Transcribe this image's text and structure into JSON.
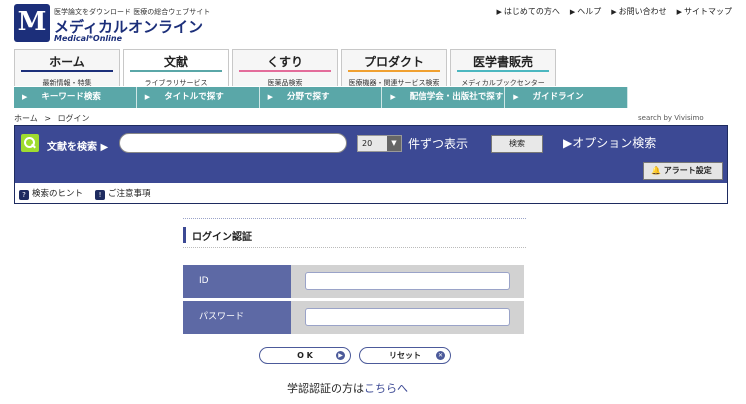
{
  "logo": {
    "mark": "M",
    "tagline": "医学論文をダウンロード 医療の総合ウェブサイト",
    "name": "メディカルオンライン",
    "name_en": "Medical*Online"
  },
  "toplinks": [
    {
      "label": "はじめての方へ"
    },
    {
      "label": "ヘルプ"
    },
    {
      "label": "お問い合わせ"
    },
    {
      "label": "サイトマップ"
    }
  ],
  "tabs": [
    {
      "title": "ホーム",
      "sub": "最新情報・特集",
      "color": "#1c2f7a"
    },
    {
      "title": "文献",
      "sub": "ライブラリサービス",
      "color": "#5aa7a8",
      "active": true
    },
    {
      "title": "くすり",
      "sub": "医薬品検索",
      "color": "#e36c9a"
    },
    {
      "title": "プロダクト",
      "sub": "医療機器・関連サービス検索",
      "color": "#f0a030"
    },
    {
      "title": "医学書販売",
      "sub": "メディカルブックセンター",
      "color": "#4bb7c0"
    }
  ],
  "nav": [
    {
      "label": "キーワード検索"
    },
    {
      "label": "タイトルで探す"
    },
    {
      "label": "分野で探す"
    },
    {
      "label": "配信学会・出版社で探す"
    },
    {
      "label": "ガイドライン"
    }
  ],
  "breadcrumb": {
    "home": "ホーム",
    "sep": ">",
    "current": "ログイン"
  },
  "search_by": "search by Vivisimo",
  "search": {
    "label": "文献を検索",
    "input_value": "",
    "count": "20",
    "per_page": "件ずつ表示",
    "button": "検索",
    "option": "オプション検索",
    "alert": "アラート設定",
    "hint": "検索のヒント",
    "notes": "ご注意事項"
  },
  "login": {
    "title": "ログイン認証",
    "id_label": "ID",
    "password_label": "パスワード",
    "ok": "O K",
    "reset": "リセット"
  },
  "footer": {
    "prefix": "学認認証の方は",
    "link": "こちらへ"
  }
}
